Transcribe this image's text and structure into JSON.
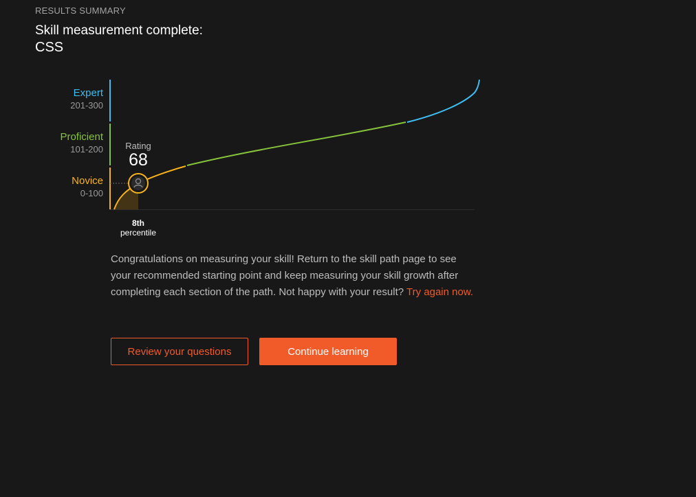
{
  "header": {
    "eyebrow": "RESULTS SUMMARY",
    "title": "Skill measurement complete:",
    "skill": "CSS"
  },
  "levels": [
    {
      "name": "Expert",
      "range": "201-300",
      "color": "#3fbdf0"
    },
    {
      "name": "Proficient",
      "range": "101-200",
      "color": "#86c43b"
    },
    {
      "name": "Novice",
      "range": "0-100",
      "color": "#f9b31b"
    }
  ],
  "rating": {
    "label": "Rating",
    "value": 68,
    "avatar_icon": "user-icon"
  },
  "percentile": {
    "rank": "8th",
    "label": "percentile"
  },
  "message": {
    "text": "Congratulations on measuring your skill! Return to the skill path page to see your recommended starting point and keep measuring your skill growth after completing each section of the path. Not happy with your result?",
    "retry_link": "Try again now."
  },
  "actions": {
    "review_label": "Review your questions",
    "continue_label": "Continue learning"
  },
  "colors": {
    "accent": "#f15b2a",
    "background": "#181818"
  }
}
